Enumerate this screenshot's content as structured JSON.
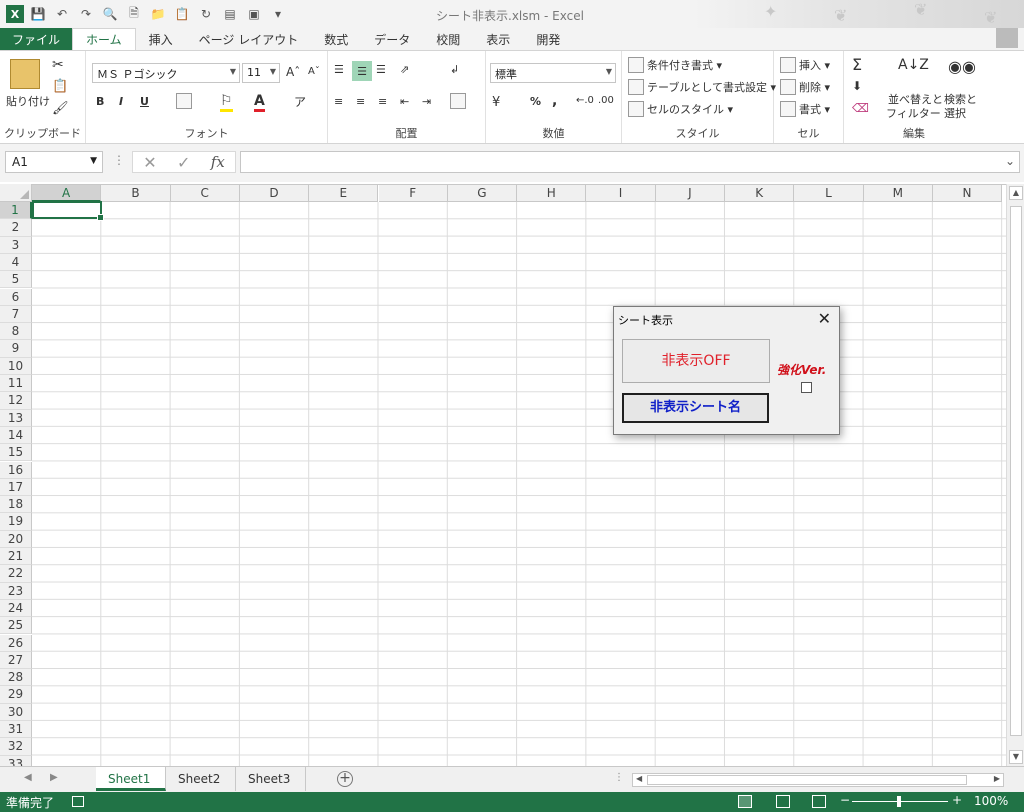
{
  "window": {
    "title": "シート非表示.xlsm - Excel"
  },
  "tabs": {
    "file": "ファイル",
    "items": [
      "ホーム",
      "挿入",
      "ページ レイアウト",
      "数式",
      "データ",
      "校閲",
      "表示",
      "開発"
    ]
  },
  "ribbon": {
    "clipboard": {
      "paste": "貼り付け",
      "label": "クリップボード"
    },
    "font": {
      "name": "ＭＳ Ｐゴシック",
      "size": "11",
      "bold": "B",
      "italic": "I",
      "underline": "U",
      "label": "フォント"
    },
    "alignment": {
      "label": "配置"
    },
    "number": {
      "format": "標準",
      "percent": "%",
      "comma": ",",
      "label": "数値"
    },
    "styles": {
      "conditional": "条件付き書式",
      "table": "テーブルとして書式設定",
      "cell": "セルのスタイル",
      "label": "スタイル"
    },
    "cells": {
      "insert": "挿入",
      "delete": "削除",
      "format": "書式",
      "label": "セル"
    },
    "editing": {
      "sort1": "並べ替えと",
      "sort2": "フィルター",
      "find1": "検索と",
      "find2": "選択",
      "label": "編集"
    }
  },
  "formula": {
    "namebox": "A1",
    "fx": "fx"
  },
  "columns": [
    "A",
    "B",
    "C",
    "D",
    "E",
    "F",
    "G",
    "H",
    "I",
    "J",
    "K",
    "L",
    "M",
    "N"
  ],
  "rows": [
    "1",
    "2",
    "3",
    "4",
    "5",
    "6",
    "7",
    "8",
    "9",
    "10",
    "11",
    "12",
    "13",
    "14",
    "15",
    "16",
    "17",
    "18",
    "19",
    "20",
    "21",
    "22",
    "23",
    "24",
    "25",
    "26",
    "27",
    "28",
    "29",
    "30",
    "31",
    "32",
    "33"
  ],
  "sheets": [
    "Sheet1",
    "Sheet2",
    "Sheet3"
  ],
  "status": {
    "ready": "準備完了",
    "zoom": "100%"
  },
  "dialog": {
    "title": "シート表示",
    "off_button": "非表示OFF",
    "name_button": "非表示シート名",
    "enhanced_label": "強化Ver.",
    "enhanced_checked": false
  },
  "colors": {
    "accent": "#217346",
    "red_text": "#e0202a",
    "blue_text": "#1020c8"
  }
}
